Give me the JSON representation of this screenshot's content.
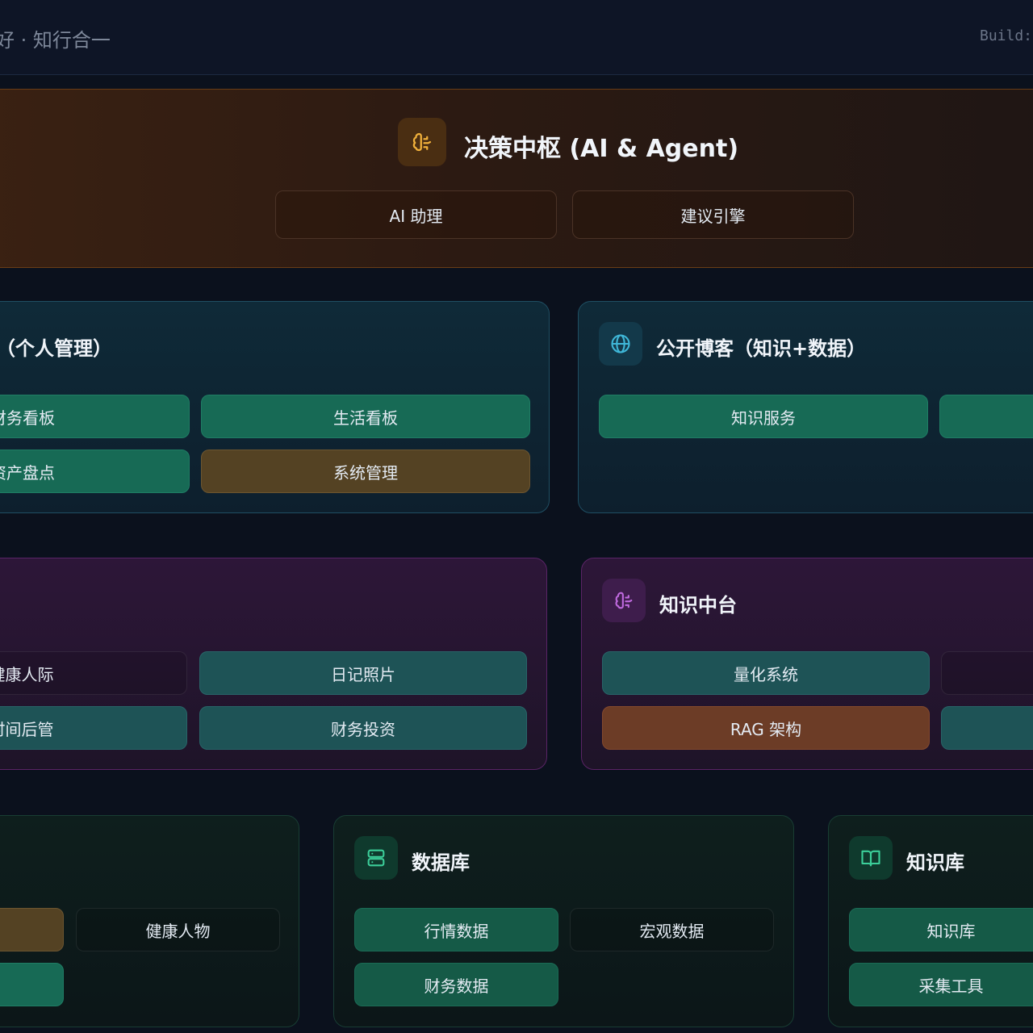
{
  "header": {
    "tagline": "好 · 知行合一",
    "build": "Build:"
  },
  "decision": {
    "title": "决策中枢 (AI & Agent)",
    "icon": "brain-icon",
    "buttons": [
      "AI 助理",
      "建议引擎"
    ]
  },
  "personal": {
    "title": "（个人管理）",
    "buttons": [
      "财务看板",
      "生活看板",
      "资产盘点",
      "系统管理"
    ]
  },
  "blog": {
    "title": "公开博客（知识+数据）",
    "icon": "globe-icon",
    "buttons": [
      "知识服务",
      ""
    ]
  },
  "life": {
    "buttons": [
      "健康人际",
      "日记照片",
      "时间后管",
      "财务投资"
    ]
  },
  "knowledge_mid": {
    "title": "知识中台",
    "icon": "brain-icon",
    "buttons": [
      "量化系统",
      "",
      "RAG 架构",
      ""
    ]
  },
  "tools": {
    "buttons": [
      "",
      "健康人物",
      ""
    ]
  },
  "database": {
    "title": "数据库",
    "icon": "database-icon",
    "buttons": [
      "行情数据",
      "宏观数据",
      "财务数据"
    ]
  },
  "kb": {
    "title": "知识库",
    "icon": "book-icon",
    "buttons": [
      "知识库",
      "采集工具"
    ]
  },
  "colors": {
    "background": "#0b111d",
    "accent_green": "#176a55",
    "accent_gold": "#544223",
    "accent_rust": "#6c3c26",
    "decision_icon": "#f1b13b",
    "blog_icon": "#3fb7d8",
    "knowledge_icon": "#c06adf",
    "db_icon": "#3ccf9a"
  }
}
